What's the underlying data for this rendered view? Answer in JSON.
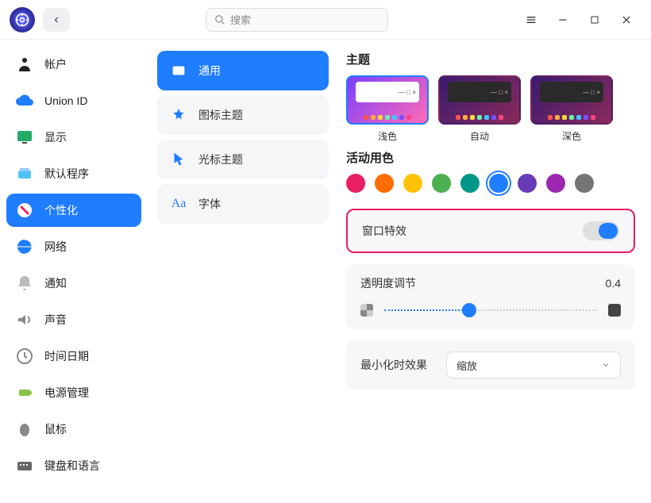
{
  "titlebar": {
    "search_placeholder": "搜索"
  },
  "sidebar": {
    "items": [
      {
        "label": "帐户",
        "icon": "account"
      },
      {
        "label": "Union ID",
        "icon": "cloud"
      },
      {
        "label": "显示",
        "icon": "display"
      },
      {
        "label": "默认程序",
        "icon": "defaults"
      },
      {
        "label": "个性化",
        "icon": "personalize",
        "active": true
      },
      {
        "label": "网络",
        "icon": "network"
      },
      {
        "label": "通知",
        "icon": "notify"
      },
      {
        "label": "声音",
        "icon": "sound"
      },
      {
        "label": "时间日期",
        "icon": "time"
      },
      {
        "label": "电源管理",
        "icon": "power"
      },
      {
        "label": "鼠标",
        "icon": "mouse"
      },
      {
        "label": "键盘和语言",
        "icon": "keyboard"
      }
    ]
  },
  "submenu": {
    "items": [
      {
        "label": "通用",
        "icon": "general",
        "active": true
      },
      {
        "label": "图标主题",
        "icon": "icontheme"
      },
      {
        "label": "光标主题",
        "icon": "cursortheme"
      },
      {
        "label": "字体",
        "icon": "font"
      }
    ]
  },
  "main": {
    "theme_title": "主题",
    "themes": [
      {
        "label": "浅色",
        "variant": "light",
        "selected": true
      },
      {
        "label": "自动",
        "variant": "auto"
      },
      {
        "label": "深色",
        "variant": "dark"
      }
    ],
    "colors_title": "活动用色",
    "colors": [
      "#e91e63",
      "#ff6d00",
      "#ffc107",
      "#4caf50",
      "#009688",
      "#1f7dff",
      "#673ab7",
      "#9c27b0",
      "#757575"
    ],
    "colors_selected_index": 5,
    "window_effects_label": "窗口特效",
    "window_effects_on": true,
    "opacity_label": "透明度调节",
    "opacity_value": "0.4",
    "opacity_percent": 40,
    "minimize_label": "最小化时效果",
    "minimize_value": "缩放"
  }
}
